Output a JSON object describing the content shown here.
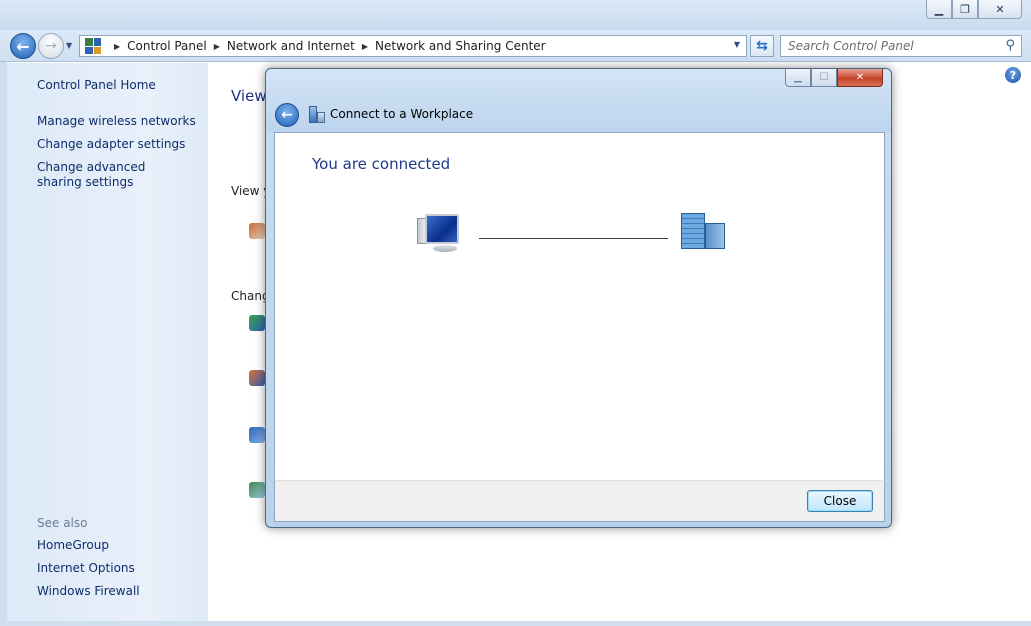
{
  "window": {
    "controls": [
      "minimize",
      "maximize",
      "close"
    ]
  },
  "navigation": {
    "back_icon": "back-arrow-icon",
    "forward_icon": "forward-arrow-icon",
    "breadcrumb": [
      "Control Panel",
      "Network and Internet",
      "Network and Sharing Center"
    ],
    "search_placeholder": "Search Control Panel"
  },
  "sidebar": {
    "home": "Control Panel Home",
    "links": [
      "Manage wireless networks",
      "Change adapter settings",
      "Change advanced sharing settings"
    ],
    "see_also_label": "See also",
    "see_also": [
      "HomeGroup",
      "Internet Options",
      "Windows Firewall"
    ]
  },
  "main": {
    "title_fragment": "View",
    "section_fragments": [
      "View y",
      "Chang"
    ]
  },
  "dialog": {
    "title": "Connect to a Workplace",
    "heading": "You are connected",
    "close_button": "Close",
    "accent_color": "#1e3a8a"
  }
}
